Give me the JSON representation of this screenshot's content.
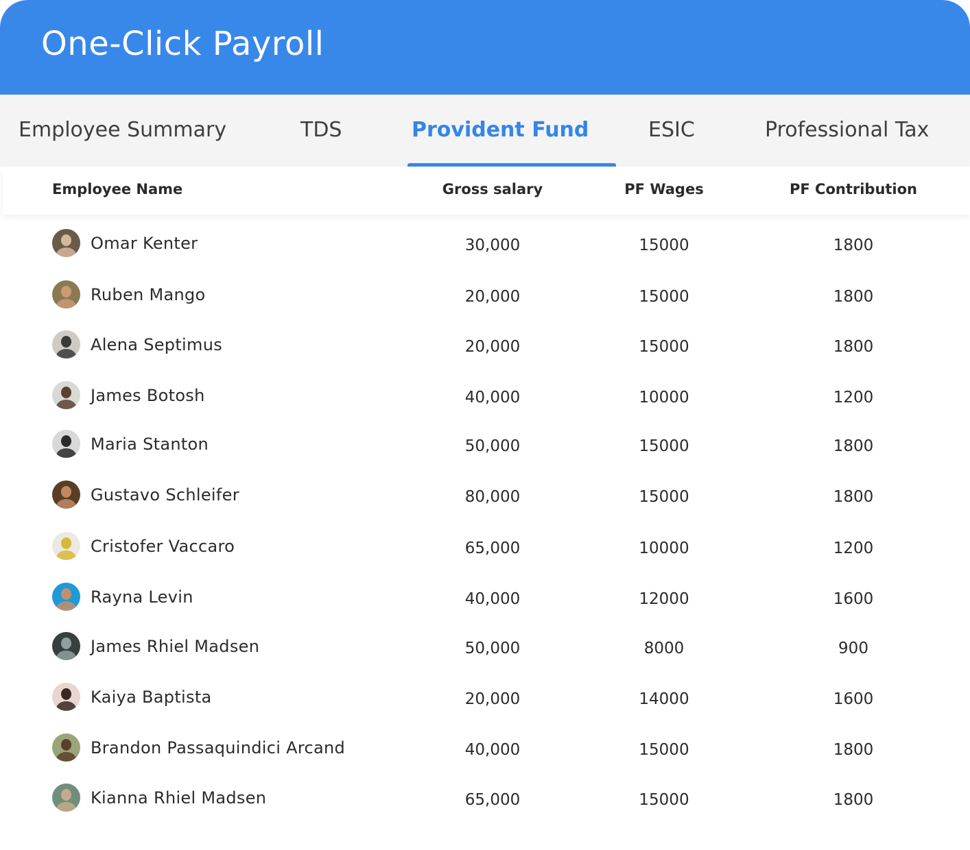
{
  "app": {
    "title": "One-Click Payroll",
    "accent_color": "#3888ea"
  },
  "tabs": [
    {
      "label": "Employee Summary",
      "active": false
    },
    {
      "label": "TDS",
      "active": false
    },
    {
      "label": "Provident Fund",
      "active": true
    },
    {
      "label": "ESIC",
      "active": false
    },
    {
      "label": "Professional Tax",
      "active": false
    }
  ],
  "table": {
    "columns": [
      "Employee Name",
      "Gross salary",
      "PF Wages",
      "PF Contribution"
    ],
    "rows": [
      {
        "name": "Omar Kenter",
        "gross": "30,000",
        "pf_wages": "15000",
        "pf_contribution": "1800",
        "avatar": "avatar-photo",
        "avatar_bg": "#6b5a4a",
        "avatar_fg": "#d6b79c"
      },
      {
        "name": "Ruben Mango",
        "gross": "20,000",
        "pf_wages": "15000",
        "pf_contribution": "1800",
        "avatar": "avatar-photo",
        "avatar_bg": "#8a7a52",
        "avatar_fg": "#c99a74"
      },
      {
        "name": "Alena Septimus",
        "gross": "20,000",
        "pf_wages": "15000",
        "pf_contribution": "1800",
        "avatar": "avatar-photo",
        "avatar_bg": "#cfcac4",
        "avatar_fg": "#3a3a3a"
      },
      {
        "name": "James Botosh",
        "gross": "40,000",
        "pf_wages": "10000",
        "pf_contribution": "1200",
        "avatar": "avatar-photo",
        "avatar_bg": "#d9d9d6",
        "avatar_fg": "#5a4232"
      },
      {
        "name": "Maria Stanton",
        "gross": "50,000",
        "pf_wages": "15000",
        "pf_contribution": "1800",
        "avatar": "avatar-photo",
        "avatar_bg": "#d8d8d8",
        "avatar_fg": "#2a2a2a"
      },
      {
        "name": "Gustavo Schleifer",
        "gross": "80,000",
        "pf_wages": "15000",
        "pf_contribution": "1800",
        "avatar": "avatar-photo",
        "avatar_bg": "#5a3d26",
        "avatar_fg": "#c08a62"
      },
      {
        "name": "Cristofer Vaccaro",
        "gross": "65,000",
        "pf_wages": "10000",
        "pf_contribution": "1200",
        "avatar": "avatar-photo",
        "avatar_bg": "#ece9e4",
        "avatar_fg": "#d8b838"
      },
      {
        "name": "Rayna Levin",
        "gross": "40,000",
        "pf_wages": "12000",
        "pf_contribution": "1600",
        "avatar": "avatar-photo",
        "avatar_bg": "#1e9ad8",
        "avatar_fg": "#c48f6c"
      },
      {
        "name": "James Rhiel Madsen",
        "gross": "50,000",
        "pf_wages": "8000",
        "pf_contribution": "900",
        "avatar": "avatar-photo",
        "avatar_bg": "#36403f",
        "avatar_fg": "#8fa0a0"
      },
      {
        "name": "Kaiya Baptista",
        "gross": "20,000",
        "pf_wages": "14000",
        "pf_contribution": "1600",
        "avatar": "avatar-photo",
        "avatar_bg": "#e8d6cf",
        "avatar_fg": "#3a2622"
      },
      {
        "name": "Brandon Passaquindici Arcand",
        "gross": "40,000",
        "pf_wages": "15000",
        "pf_contribution": "1800",
        "avatar": "avatar-photo",
        "avatar_bg": "#9aa57a",
        "avatar_fg": "#5c3f2a"
      },
      {
        "name": "Kianna Rhiel Madsen",
        "gross": "65,000",
        "pf_wages": "15000",
        "pf_contribution": "1800",
        "avatar": "avatar-photo",
        "avatar_bg": "#6f8f7c",
        "avatar_fg": "#c9a98c"
      }
    ]
  }
}
